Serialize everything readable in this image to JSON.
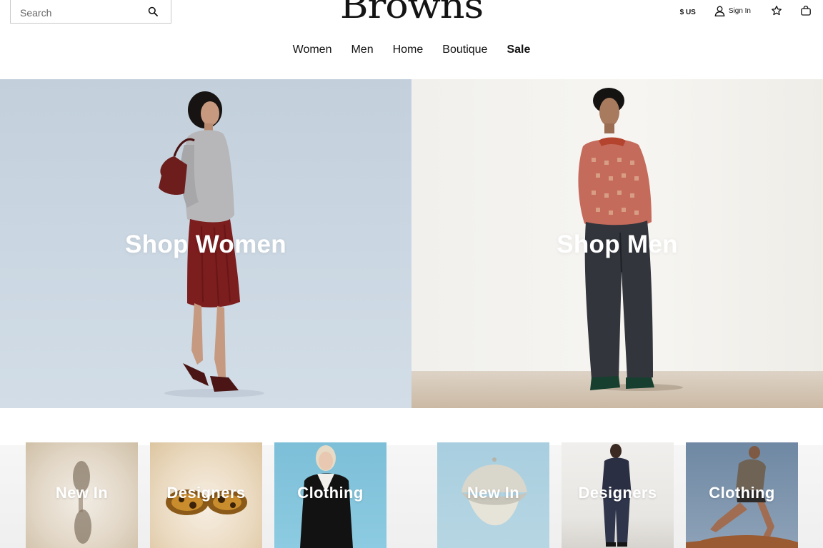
{
  "header": {
    "search_placeholder": "Search",
    "logo_text": "Browns",
    "currency": "$ US",
    "sign_in": "Sign In"
  },
  "nav": {
    "items": [
      {
        "label": "Women"
      },
      {
        "label": "Men"
      },
      {
        "label": "Home"
      },
      {
        "label": "Boutique"
      },
      {
        "label": "Sale"
      }
    ]
  },
  "hero": {
    "women_label": "Shop Women",
    "men_label": "Shop Men"
  },
  "categories": {
    "women": [
      {
        "label": "New In"
      },
      {
        "label": "Designers"
      },
      {
        "label": "Clothing"
      }
    ],
    "men": [
      {
        "label": "New In"
      },
      {
        "label": "Designers"
      },
      {
        "label": "Clothing"
      }
    ]
  },
  "colors": {
    "text": "#111111",
    "women_backdrop": "#c8d5e0",
    "men_backdrop": "#f3f2ee"
  }
}
